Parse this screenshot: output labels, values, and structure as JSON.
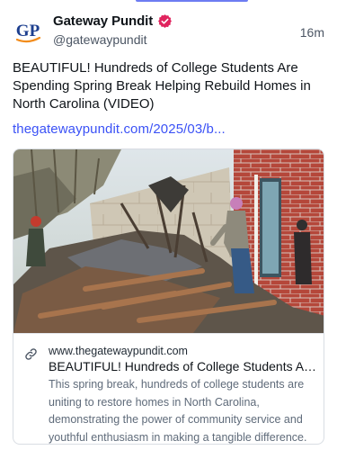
{
  "post": {
    "author_name": "Gateway Pundit",
    "author_handle": "@gatewaypundit",
    "avatar_text": "GP",
    "timestamp": "16m",
    "text": "BEAUTIFUL! Hundreds of College Students Are Spending Spring Break Helping Rebuild Homes in North Carolina (VIDEO)",
    "link_text": "thegatewaypundit.com/2025/03/b..."
  },
  "card": {
    "domain": "www.thegatewaypundit.com",
    "title": "BEAUTIFUL! Hundreds of College Students Are Spending Spring Break Helping Rebuild Homes in North Carolina (VIDEO)",
    "description": "This spring break, hundreds of college students are uniting to restore homes in North Carolina, demonstrating the power of community service and youthful enthusiasm in making a tangible difference."
  },
  "icons": {
    "verified": "verified-badge-icon",
    "link": "link-icon"
  },
  "colors": {
    "accent": "#3b52f6",
    "verified": "#e0245e",
    "avatar_blue": "#1d3f8f",
    "avatar_orange": "#f28c1b",
    "top_accent": "#6d7cf2"
  }
}
